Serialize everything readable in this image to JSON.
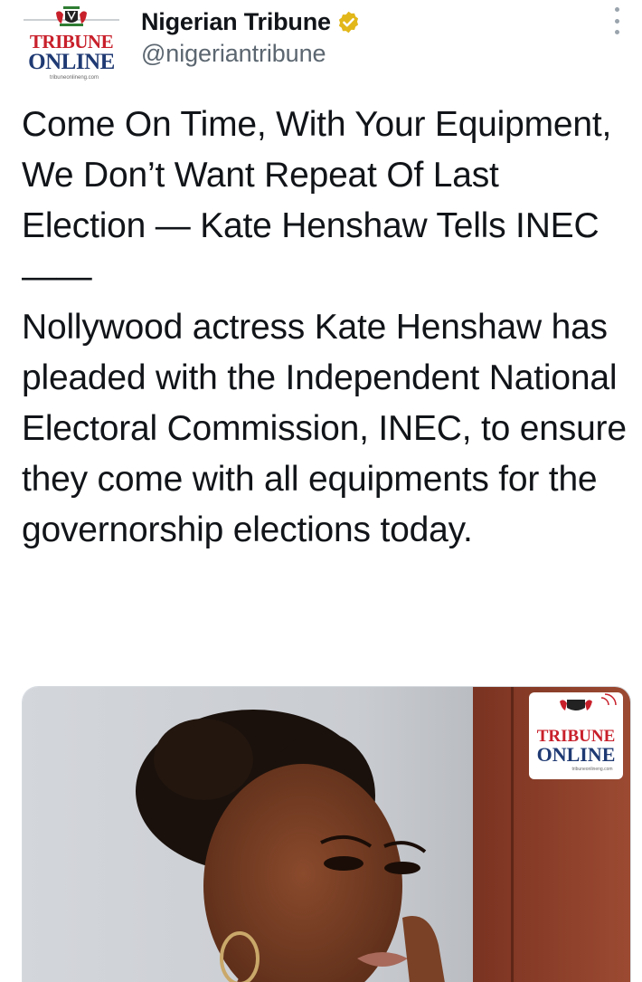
{
  "account": {
    "display_name": "Nigerian Tribune",
    "handle": "@nigeriantribune",
    "avatar_logo_line1": "TRIBUNE",
    "avatar_logo_line2": "ONLINE",
    "avatar_logo_url": "tribuneonlineng.com"
  },
  "tweet": {
    "headline": "Come On Time, With Your Equipment, We Don’t Want Repeat Of Last Election — Kate Henshaw Tells INEC",
    "separator": "——",
    "body": "Nollywood actress Kate Henshaw has pleaded with the Independent National Electoral Commission, INEC, to ensure they come with all equipments for the governorship elections today."
  },
  "media": {
    "watermark_line1": "TRIBUNE",
    "watermark_line2": "ONLINE",
    "watermark_url": "tribuneonlineng.com"
  },
  "icons": {
    "verified": "verified-badge-icon",
    "more": "more-options-icon"
  },
  "colors": {
    "verified_gold": "#E2B719",
    "logo_red": "#C8202B",
    "logo_navy": "#1F3A73",
    "handle_gray": "#5B6670"
  }
}
